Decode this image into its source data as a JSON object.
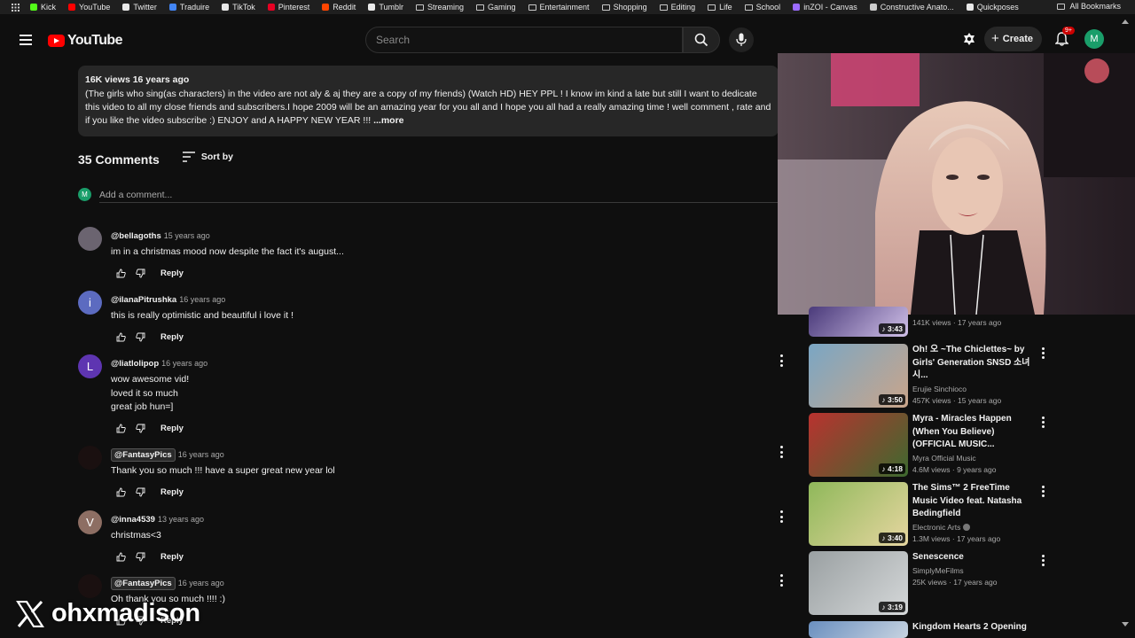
{
  "bookmarks": {
    "items": [
      {
        "label": "Kick",
        "icon": "kick-icon",
        "color": "#53fc18"
      },
      {
        "label": "YouTube",
        "icon": "youtube-icon",
        "color": "#ff0000"
      },
      {
        "label": "Twitter",
        "icon": "x-icon",
        "color": "#e8e8e8"
      },
      {
        "label": "Traduire",
        "icon": "translate-icon",
        "color": "#4285f4"
      },
      {
        "label": "TikTok",
        "icon": "tiktok-icon",
        "color": "#e8e8e8"
      },
      {
        "label": "Pinterest",
        "icon": "pinterest-icon",
        "color": "#e60023"
      },
      {
        "label": "Reddit",
        "icon": "reddit-icon",
        "color": "#ff4500"
      },
      {
        "label": "Tumblr",
        "icon": "tumblr-icon",
        "color": "#e8e8e8"
      },
      {
        "label": "Streaming",
        "icon": "folder-icon"
      },
      {
        "label": "Gaming",
        "icon": "folder-icon"
      },
      {
        "label": "Entertainment",
        "icon": "folder-icon"
      },
      {
        "label": "Shopping",
        "icon": "folder-icon"
      },
      {
        "label": "Editing",
        "icon": "folder-icon"
      },
      {
        "label": "Life",
        "icon": "folder-icon"
      },
      {
        "label": "School",
        "icon": "folder-icon"
      },
      {
        "label": "inZOI - Canvas",
        "icon": "inzoi-icon",
        "color": "#9b6bff"
      },
      {
        "label": "Constructive Anato...",
        "icon": "page-icon",
        "color": "#cccccc"
      },
      {
        "label": "Quickposes",
        "icon": "quickposes-icon",
        "color": "#e8e8e8"
      }
    ],
    "all_bookmarks": "All Bookmarks"
  },
  "header": {
    "logo_text": "YouTube",
    "search_placeholder": "Search",
    "create_label": "Create",
    "notif_count": "9+",
    "avatar_letter": "M"
  },
  "description": {
    "meta": "16K views  16 years ago",
    "text": "(The girls who sing(as characters) in the video are not aly & aj they are a copy of my friends) (Watch HD) HEY PPL ! I know im kind a late but still I want to dedicate this video to all my close friends and subscribers.I hope 2009 will be an amazing year for you all and I hope you all had a really amazing time ! well comment , rate and if you like the video subscribe :) ENJOY and A HAPPY NEW YEAR !!! ",
    "more": "...more"
  },
  "comments_section": {
    "count_label": "35 Comments",
    "sort_label": "Sort by",
    "add_placeholder": "Add a comment...",
    "add_avatar_letter": "M",
    "reply_label": "Reply",
    "comments": [
      {
        "author": "@bellagoths",
        "time": "15 years ago",
        "text": "im in a christmas mood now despite the fact it's august...",
        "avatar_letter": "",
        "avatar_color": "#6b6470"
      },
      {
        "author": "@ilanaPitrushka",
        "time": "16 years ago",
        "text": "this is really optimistic and beautiful i love it !",
        "avatar_letter": "i",
        "avatar_color": "#5c6bc0"
      },
      {
        "author": "@liatlolipop",
        "time": "16 years ago",
        "text": "wow awesome vid!\nloved it so much\ngreat job hun=]",
        "avatar_letter": "L",
        "avatar_color": "#5e35b1"
      },
      {
        "author": "@FantasyPics",
        "time": "16 years ago",
        "text": "Thank you so much !!! have a super great new year lol",
        "avatar_letter": "",
        "avatar_color": "#1a1010"
      },
      {
        "author": "@inna4539",
        "time": "13 years ago",
        "text": "christmas<3",
        "avatar_letter": "V",
        "avatar_color": "#8d6e63"
      },
      {
        "author": "@FantasyPics",
        "time": "16 years ago",
        "text": "Oh thank you so much !!!! :)",
        "avatar_letter": "",
        "avatar_color": "#1a1010"
      }
    ]
  },
  "sidebar": {
    "videos": [
      {
        "title": "",
        "channel": "",
        "meta": "141K views · 17 years ago",
        "duration": "3:43",
        "verified": false
      },
      {
        "title": "Oh! 오 ~The Chiclettes~ by Girls' Generation SNSD 소녀시...",
        "channel": "Erujie Sinchioco",
        "meta": "457K views · 15 years ago",
        "duration": "3:50",
        "verified": false
      },
      {
        "title": "Myra - Miracles Happen (When You Believe) (OFFICIAL MUSIC...",
        "channel": "Myra Official Music",
        "meta": "4.6M views · 9 years ago",
        "duration": "4:18",
        "verified": false
      },
      {
        "title": "The Sims™ 2 FreeTime Music Video feat. Natasha Bedingfield",
        "channel": "Electronic Arts",
        "meta": "1.3M views · 17 years ago",
        "duration": "3:40",
        "verified": true
      },
      {
        "title": "Senescence",
        "channel": "SimplyMeFilms",
        "meta": "25K views · 17 years ago",
        "duration": "3:19",
        "verified": false
      },
      {
        "title": "Kingdom Hearts 2 Opening",
        "channel": "",
        "meta": "",
        "duration": "",
        "verified": false
      }
    ]
  },
  "watermark": {
    "text": "ohxmadison"
  }
}
